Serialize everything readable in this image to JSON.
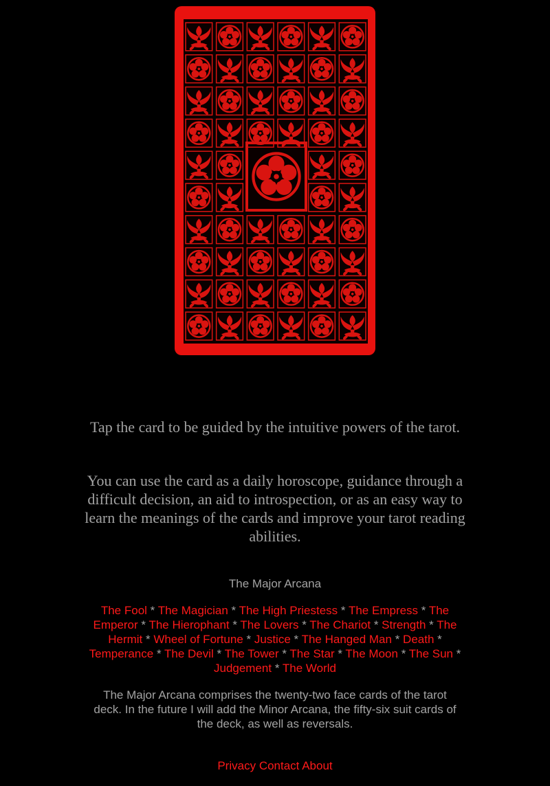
{
  "card": {
    "name": "tarot-card-back",
    "colors": {
      "frame": "#e8120f",
      "ink": "#0a0000",
      "pattern": "#d91410"
    }
  },
  "intro": {
    "tap_text": "Tap the card to be guided by the intuitive powers of the tarot.",
    "use_text": "You can use the card as a daily horoscope, guidance through a difficult decision, an aid to introspection, or as an easy way to learn the meanings of the cards and improve your tarot reading abilities."
  },
  "major_arcana": {
    "heading": "The Major Arcana",
    "separator": "*",
    "cards": [
      "The Fool",
      "The Magician",
      "The High Priestess",
      "The Empress",
      "The Emperor",
      "The Hierophant",
      "The Lovers",
      "The Chariot",
      "Strength",
      "The Hermit",
      "Wheel of Fortune",
      "Justice",
      "The Hanged Man",
      "Death",
      "Temperance",
      "The Devil",
      "The Tower",
      "The Star",
      "The Moon",
      "The Sun",
      "Judgement",
      "The World"
    ],
    "note": "The Major Arcana comprises the twenty-two face cards of the tarot deck. In the future I will add the Minor Arcana, the fifty-six suit cards of the deck, as well as reversals."
  },
  "footer": {
    "links": [
      "Privacy",
      "Contact",
      "About"
    ]
  },
  "colors": {
    "background": "#000000",
    "text": "#a3a3a3",
    "link": "#ff1a1a"
  }
}
